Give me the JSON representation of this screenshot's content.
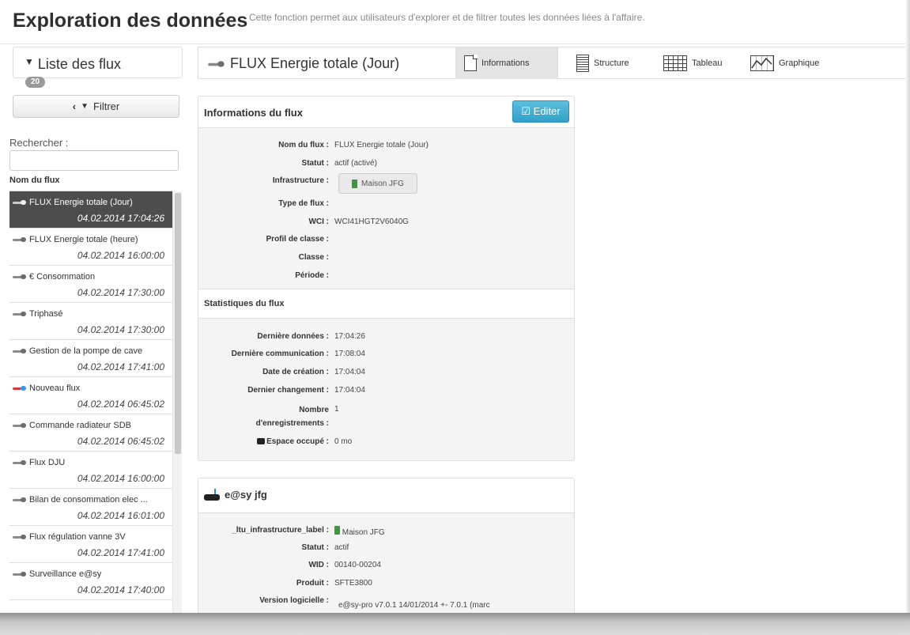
{
  "header": {
    "title": "Exploration des données",
    "description": "Cette fonction permet aux utilisateurs d'explorer et de filtrer toutes les données liées à l'affaire."
  },
  "sidebar": {
    "title": "Liste des flux",
    "count": "20",
    "filter_label": "Filtrer",
    "search_label": "Rechercher :",
    "search_value": "",
    "column_header": "Nom du flux",
    "items": [
      {
        "name": "FLUX Energie totale (Jour)",
        "date": "04.02.2014 17:04:26",
        "icon": "flux-icon"
      },
      {
        "name": "FLUX Energie totale (heure)",
        "date": "04.02.2014 16:00:00",
        "icon": "flux-icon"
      },
      {
        "name": "€ Consommation",
        "date": "04.02.2014 17:30:00",
        "icon": "flux-icon"
      },
      {
        "name": "Triphasé",
        "date": "04.02.2014 17:30:00",
        "icon": "flux-icon"
      },
      {
        "name": "Gestion de la pompe de cave",
        "date": "04.02.2014 17:41:00",
        "icon": "flux-icon"
      },
      {
        "name": "Nouveau flux",
        "date": "04.02.2014 06:45:02",
        "icon": "new-flux-icon"
      },
      {
        "name": "Commande radiateur SDB",
        "date": "04.02.2014 06:45:02",
        "icon": "flux-icon"
      },
      {
        "name": "Flux DJU",
        "date": "04.02.2014 16:00:00",
        "icon": "flux-icon"
      },
      {
        "name": "Bilan de consommation elec ...",
        "date": "04.02.2014 16:01:00",
        "icon": "flux-icon"
      },
      {
        "name": "Flux régulation vanne 3V",
        "date": "04.02.2014 17:41:00",
        "icon": "flux-icon"
      },
      {
        "name": "Surveillance e@sy",
        "date": "04.02.2014 17:40:00",
        "icon": "flux-icon"
      }
    ]
  },
  "tabbar": {
    "flux_title": "FLUX Energie totale (Jour)",
    "tabs": [
      {
        "label": "Informations",
        "icon": "document-icon",
        "active": true
      },
      {
        "label": "Structure",
        "icon": "lines-icon"
      },
      {
        "label": "Tableau",
        "icon": "table-icon"
      },
      {
        "label": "Graphique",
        "icon": "chart-icon"
      }
    ]
  },
  "info_panel": {
    "title": "Informations du flux",
    "edit_label": "Editer",
    "fields": {
      "nom": {
        "key": "Nom du flux :",
        "value": "FLUX Energie totale (Jour)"
      },
      "statut": {
        "key": "Statut :",
        "value": "actif (activé)"
      },
      "infra": {
        "key": "Infrastructure :",
        "value": "Maison JFG"
      },
      "type": {
        "key": "Type de flux :",
        "value": ""
      },
      "wci": {
        "key": "WCI :",
        "value": "WCI41HGT2V6040G"
      },
      "profil": {
        "key": "Profil de classe :",
        "value": ""
      },
      "classe": {
        "key": "Classe :",
        "value": ""
      },
      "periode": {
        "key": "Période :",
        "value": ""
      }
    },
    "stats_title": "Statistiques du flux",
    "stats": {
      "derniere_donnees": {
        "key": "Dernière données :",
        "value": "17:04:26"
      },
      "derniere_comm": {
        "key": "Dernière communication :",
        "value": "17:08:04"
      },
      "creation": {
        "key": "Date de création :",
        "value": "17:04:04"
      },
      "changement": {
        "key": "Dernier changement :",
        "value": "17:04:04"
      },
      "nombre_key_1": "Nombre",
      "nombre_key_2": "d'enregistrements :",
      "nombre_value": "1",
      "espace": {
        "key": "Espace occupé :",
        "value": "0 mo"
      }
    }
  },
  "device_panel": {
    "title": "e@sy jfg",
    "fields": {
      "infra_label": {
        "key": "_ltu_infrastructure_label :",
        "value": "Maison JFG"
      },
      "statut": {
        "key": "Statut :",
        "value": "actif"
      },
      "wid": {
        "key": "WID :",
        "value": "00140-00204"
      },
      "produit": {
        "key": "Produit :",
        "value": "SFTE3800"
      },
      "version": {
        "key": "Version logicielle :",
        "value": "e@sy-pro v7.0.1 14/01/2014 +- 7.0.1 (marc"
      }
    }
  }
}
